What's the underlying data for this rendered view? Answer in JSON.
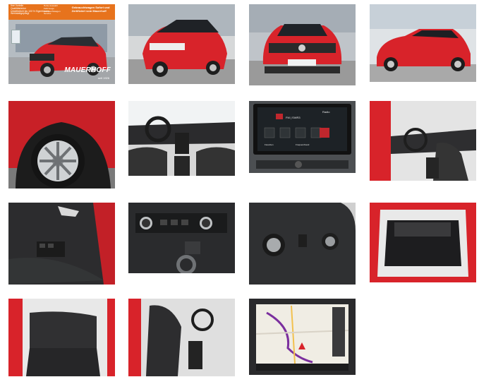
{
  "gallery": {
    "photos": [
      {
        "name": "front-left-exterior",
        "banner": {
          "left": [
            "Ihre Vorteile",
            "Qualitätsfaktor",
            "Unfallfreiheit bis 100 % Eigentümers",
            "Werkstattgepflegt"
          ],
          "middle": [
            "Hohe Auswahl",
            "Fahrzeuge",
            "Gebrauchtwagen",
            "Service"
          ],
          "right": "Gebrauchtwagen Sofort und Zertifiziert vom Mauerhoff"
        },
        "logo": "MAUERHOFF",
        "logo_sub": "seit 1926"
      },
      {
        "name": "rear-left-exterior"
      },
      {
        "name": "front-exterior"
      },
      {
        "name": "side-exterior"
      },
      {
        "name": "wheel-closeup"
      },
      {
        "name": "dashboard-interior"
      },
      {
        "name": "infotainment-radio",
        "screen": {
          "station": "FM | SWR3",
          "header": "Radio",
          "labels": [
            "Favoriten",
            "Frequenzband"
          ]
        }
      },
      {
        "name": "driver-seat-interior"
      },
      {
        "name": "door-panel"
      },
      {
        "name": "climate-controls"
      },
      {
        "name": "light-switch-panel"
      },
      {
        "name": "trunk-interior"
      },
      {
        "name": "rear-seats"
      },
      {
        "name": "front-seats-passenger-view"
      },
      {
        "name": "navigation-screen"
      }
    ]
  },
  "colors": {
    "car_red": "#d8232a",
    "banner_orange": "#e7731d",
    "dark_interior": "#2b2b2d"
  }
}
